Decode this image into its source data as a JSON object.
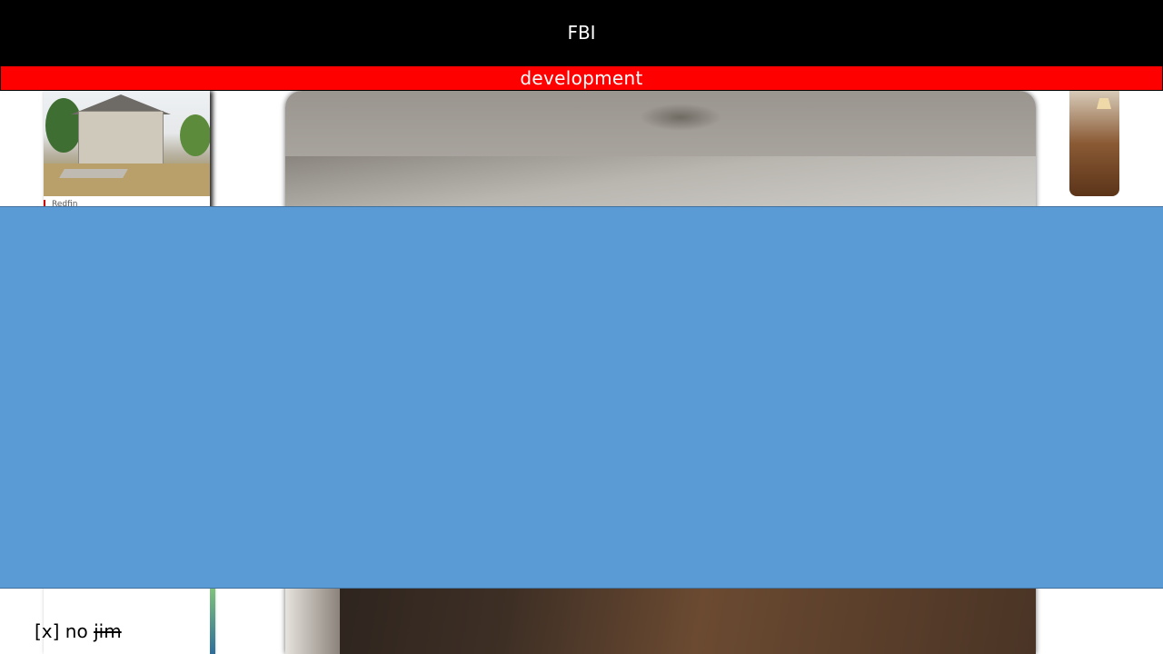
{
  "header": {
    "title": "FBI"
  },
  "environment_bar": {
    "label": "development"
  },
  "listing": {
    "source": "Redfin"
  },
  "checkbox_line": {
    "prefix": "[x] no",
    "struck_word": "jim"
  },
  "colors": {
    "header_bg": "#000000",
    "environment_bg": "#ff0000",
    "overlay_bg": "#5b9bd5"
  }
}
